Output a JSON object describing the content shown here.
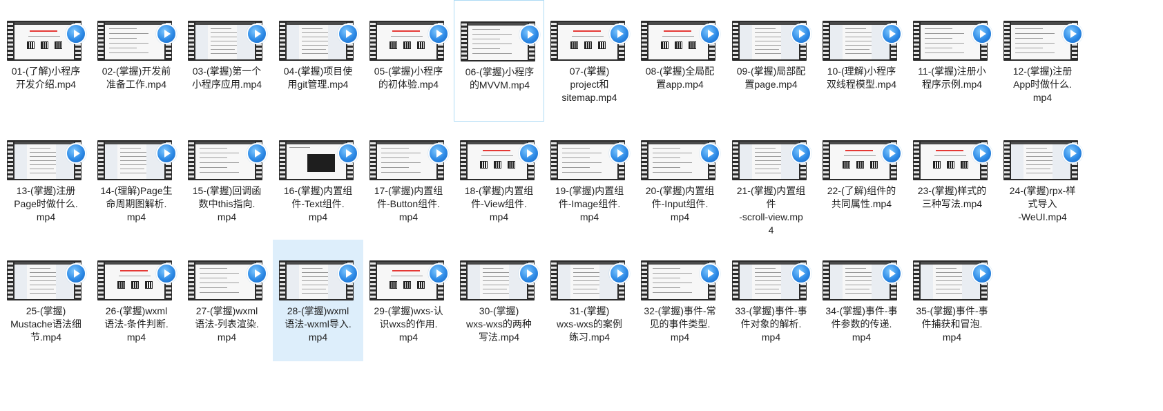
{
  "folder": {
    "items": [
      {
        "name": "01-(了解)小程序开发介绍.mp4",
        "lines": [
          "01-(了解)小程序",
          "开发介绍.mp4"
        ],
        "thumb": "logo-qr"
      },
      {
        "name": "02-(掌握)开发前准备工作.mp4",
        "lines": [
          "02-(掌握)开发前",
          "准备工作.mp4"
        ],
        "thumb": "doc"
      },
      {
        "name": "03-(掌握)第一个小程序应用.mp4",
        "lines": [
          "03-(掌握)第一个",
          "小程序应用.mp4"
        ],
        "thumb": "ide"
      },
      {
        "name": "04-(掌握)项目使用git管理.mp4",
        "lines": [
          "04-(掌握)项目使",
          "用git管理.mp4"
        ],
        "thumb": "ide"
      },
      {
        "name": "05-(掌握)小程序的初体验.mp4",
        "lines": [
          "05-(掌握)小程序",
          "的初体验.mp4"
        ],
        "thumb": "logo-qr"
      },
      {
        "name": "06-(掌握)小程序的MVVM.mp4",
        "lines": [
          "06-(掌握)小程序",
          "的MVVM.mp4"
        ],
        "thumb": "doc"
      },
      {
        "name": "07-(掌握)project和sitemap.mp4",
        "lines": [
          "07-(掌握)",
          "project和",
          "sitemap.mp4"
        ],
        "thumb": "red-qr"
      },
      {
        "name": "08-(掌握)全局配置app.mp4",
        "lines": [
          "08-(掌握)全局配",
          "置app.mp4"
        ],
        "thumb": "red-qr"
      },
      {
        "name": "09-(掌握)局部配置page.mp4",
        "lines": [
          "09-(掌握)局部配",
          "置page.mp4"
        ],
        "thumb": "ide"
      },
      {
        "name": "10-(理解)小程序双线程模型.mp4",
        "lines": [
          "10-(理解)小程序",
          "双线程模型.mp4"
        ],
        "thumb": "ide"
      },
      {
        "name": "11-(掌握)注册小程序示例.mp4",
        "lines": [
          "11-(掌握)注册小",
          "程序示例.mp4"
        ],
        "thumb": "doc"
      },
      {
        "name": "12-(掌握)注册App时做什么.mp4",
        "lines": [
          "12-(掌握)注册",
          "App时做什么.",
          "mp4"
        ],
        "thumb": "doc"
      },
      {
        "name": "13-(掌握)注册Page时做什么.mp4",
        "lines": [
          "13-(掌握)注册",
          "Page时做什么.",
          "mp4"
        ],
        "thumb": "ide"
      },
      {
        "name": "14-(理解)Page生命周期图解析.mp4",
        "lines": [
          "14-(理解)Page生",
          "命周期图解析.",
          "mp4"
        ],
        "thumb": "ide"
      },
      {
        "name": "15-(掌握)回调函数中this指向.mp4",
        "lines": [
          "15-(掌握)回调函",
          "数中this指向.",
          "mp4"
        ],
        "thumb": "doc"
      },
      {
        "name": "16-(掌握)内置组件-Text组件.mp4",
        "lines": [
          "16-(掌握)内置组",
          "件-Text组件.",
          "mp4"
        ],
        "thumb": "dark"
      },
      {
        "name": "17-(掌握)内置组件-Button组件.mp4",
        "lines": [
          "17-(掌握)内置组",
          "件-Button组件.",
          "mp4"
        ],
        "thumb": "doc"
      },
      {
        "name": "18-(掌握)内置组件-View组件.mp4",
        "lines": [
          "18-(掌握)内置组",
          "件-View组件.",
          "mp4"
        ],
        "thumb": "red-qr"
      },
      {
        "name": "19-(掌握)内置组件-Image组件.mp4",
        "lines": [
          "19-(掌握)内置组",
          "件-Image组件.",
          "mp4"
        ],
        "thumb": "doc"
      },
      {
        "name": "20-(掌握)内置组件-Input组件.mp4",
        "lines": [
          "20-(掌握)内置组",
          "件-Input组件.",
          "mp4"
        ],
        "thumb": "doc"
      },
      {
        "name": "21-(掌握)内置组件-scroll-view.mp4",
        "lines": [
          "21-(掌握)内置组",
          "件",
          "-scroll-view.mp",
          "4"
        ],
        "thumb": "ide"
      },
      {
        "name": "22-(了解)组件的共同属性.mp4",
        "lines": [
          "22-(了解)组件的",
          "共同属性.mp4"
        ],
        "thumb": "red-qr"
      },
      {
        "name": "23-(掌握)样式的三种写法.mp4",
        "lines": [
          "23-(掌握)样式的",
          "三种写法.mp4"
        ],
        "thumb": "red-qr"
      },
      {
        "name": "24-(掌握)rpx-样式导入-WeUI.mp4",
        "lines": [
          "24-(掌握)rpx-样",
          "式导入",
          "-WeUI.mp4"
        ],
        "thumb": "ide"
      },
      {
        "name": "25-(掌握)Mustache语法细节.mp4",
        "lines": [
          "25-(掌握)",
          "Mustache语法细",
          "节.mp4"
        ],
        "thumb": "ide"
      },
      {
        "name": "26-(掌握)wxml语法-条件判断.mp4",
        "lines": [
          "26-(掌握)wxml",
          "语法-条件判断.",
          "mp4"
        ],
        "thumb": "red-qr"
      },
      {
        "name": "27-(掌握)wxml语法-列表渲染.mp4",
        "lines": [
          "27-(掌握)wxml",
          "语法-列表渲染.",
          "mp4"
        ],
        "thumb": "doc"
      },
      {
        "name": "28-(掌握)wxml语法-wxml导入.mp4",
        "lines": [
          "28-(掌握)wxml",
          "语法-wxml导入.",
          "mp4"
        ],
        "thumb": "ide"
      },
      {
        "name": "29-(掌握)wxs-认识wxs的作用.mp4",
        "lines": [
          "29-(掌握)wxs-认",
          "识wxs的作用.",
          "mp4"
        ],
        "thumb": "red-qr"
      },
      {
        "name": "30-(掌握)wxs-wxs的两种写法.mp4",
        "lines": [
          "30-(掌握)",
          "wxs-wxs的两种",
          "写法.mp4"
        ],
        "thumb": "ide"
      },
      {
        "name": "31-(掌握)wxs-wxs的案例练习.mp4",
        "lines": [
          "31-(掌握)",
          "wxs-wxs的案例",
          "练习.mp4"
        ],
        "thumb": "ide"
      },
      {
        "name": "32-(掌握)事件-常见的事件类型.mp4",
        "lines": [
          "32-(掌握)事件-常",
          "见的事件类型.",
          "mp4"
        ],
        "thumb": "doc"
      },
      {
        "name": "33-(掌握)事件-事件对象的解析.mp4",
        "lines": [
          "33-(掌握)事件-事",
          "件对象的解析.",
          "mp4"
        ],
        "thumb": "ide"
      },
      {
        "name": "34-(掌握)事件-事件参数的传递.mp4",
        "lines": [
          "34-(掌握)事件-事",
          "件参数的传递.",
          "mp4"
        ],
        "thumb": "ide"
      },
      {
        "name": "35-(掌握)事件-事件捕获和冒泡.mp4",
        "lines": [
          "35-(掌握)事件-事",
          "件捕获和冒泡.",
          "mp4"
        ],
        "thumb": "ide"
      }
    ],
    "hovered_index": 5,
    "selected_index": 27,
    "colors": {
      "selected_bg": "#ddeefb",
      "hover_border": "#aedbf5",
      "play_button": "#2d8ae6",
      "accent_red": "#e53935"
    },
    "icons": {
      "thumbnail_badge": "play-icon",
      "thumbnail_frame": "film-strip-icon"
    }
  }
}
